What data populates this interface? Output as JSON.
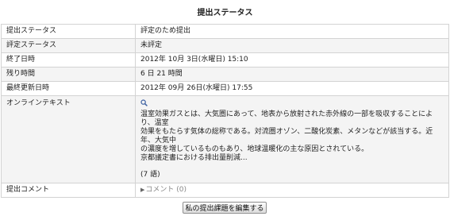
{
  "page": {
    "title": "提出ステータス"
  },
  "rows": [
    {
      "label": "提出ステータス",
      "value": "評定のため提出"
    },
    {
      "label": "評定ステータス",
      "value": "未評定"
    },
    {
      "label": "終了日時",
      "value": "2012年 10月 3日(水曜日) 15:10"
    },
    {
      "label": "残り時間",
      "value": "6 日 21 時間"
    },
    {
      "label": "最終更新日時",
      "value": "2012年 09月 26日(水曜日) 17:55"
    }
  ],
  "online_text": {
    "label": "オンラインテキスト",
    "icon": "search-icon",
    "lines": [
      "温室効果ガスとは、大気圏にあって、地表から放射された赤外線の一部を吸収することにより、温室",
      "効果をもたらす気体の総称である。対流圏オゾン、二酸化炭素、メタンなどが該当する。近年、大気中",
      "の濃度を増しているものもあり、地球温暖化の主な原因とされている。",
      "京都議定書における排出量削減..."
    ],
    "word_count": "(7 語)"
  },
  "comments": {
    "label": "提出コメント",
    "link_text": "コメント (0)"
  },
  "actions": {
    "edit_button": "私の提出課題を編集する"
  }
}
